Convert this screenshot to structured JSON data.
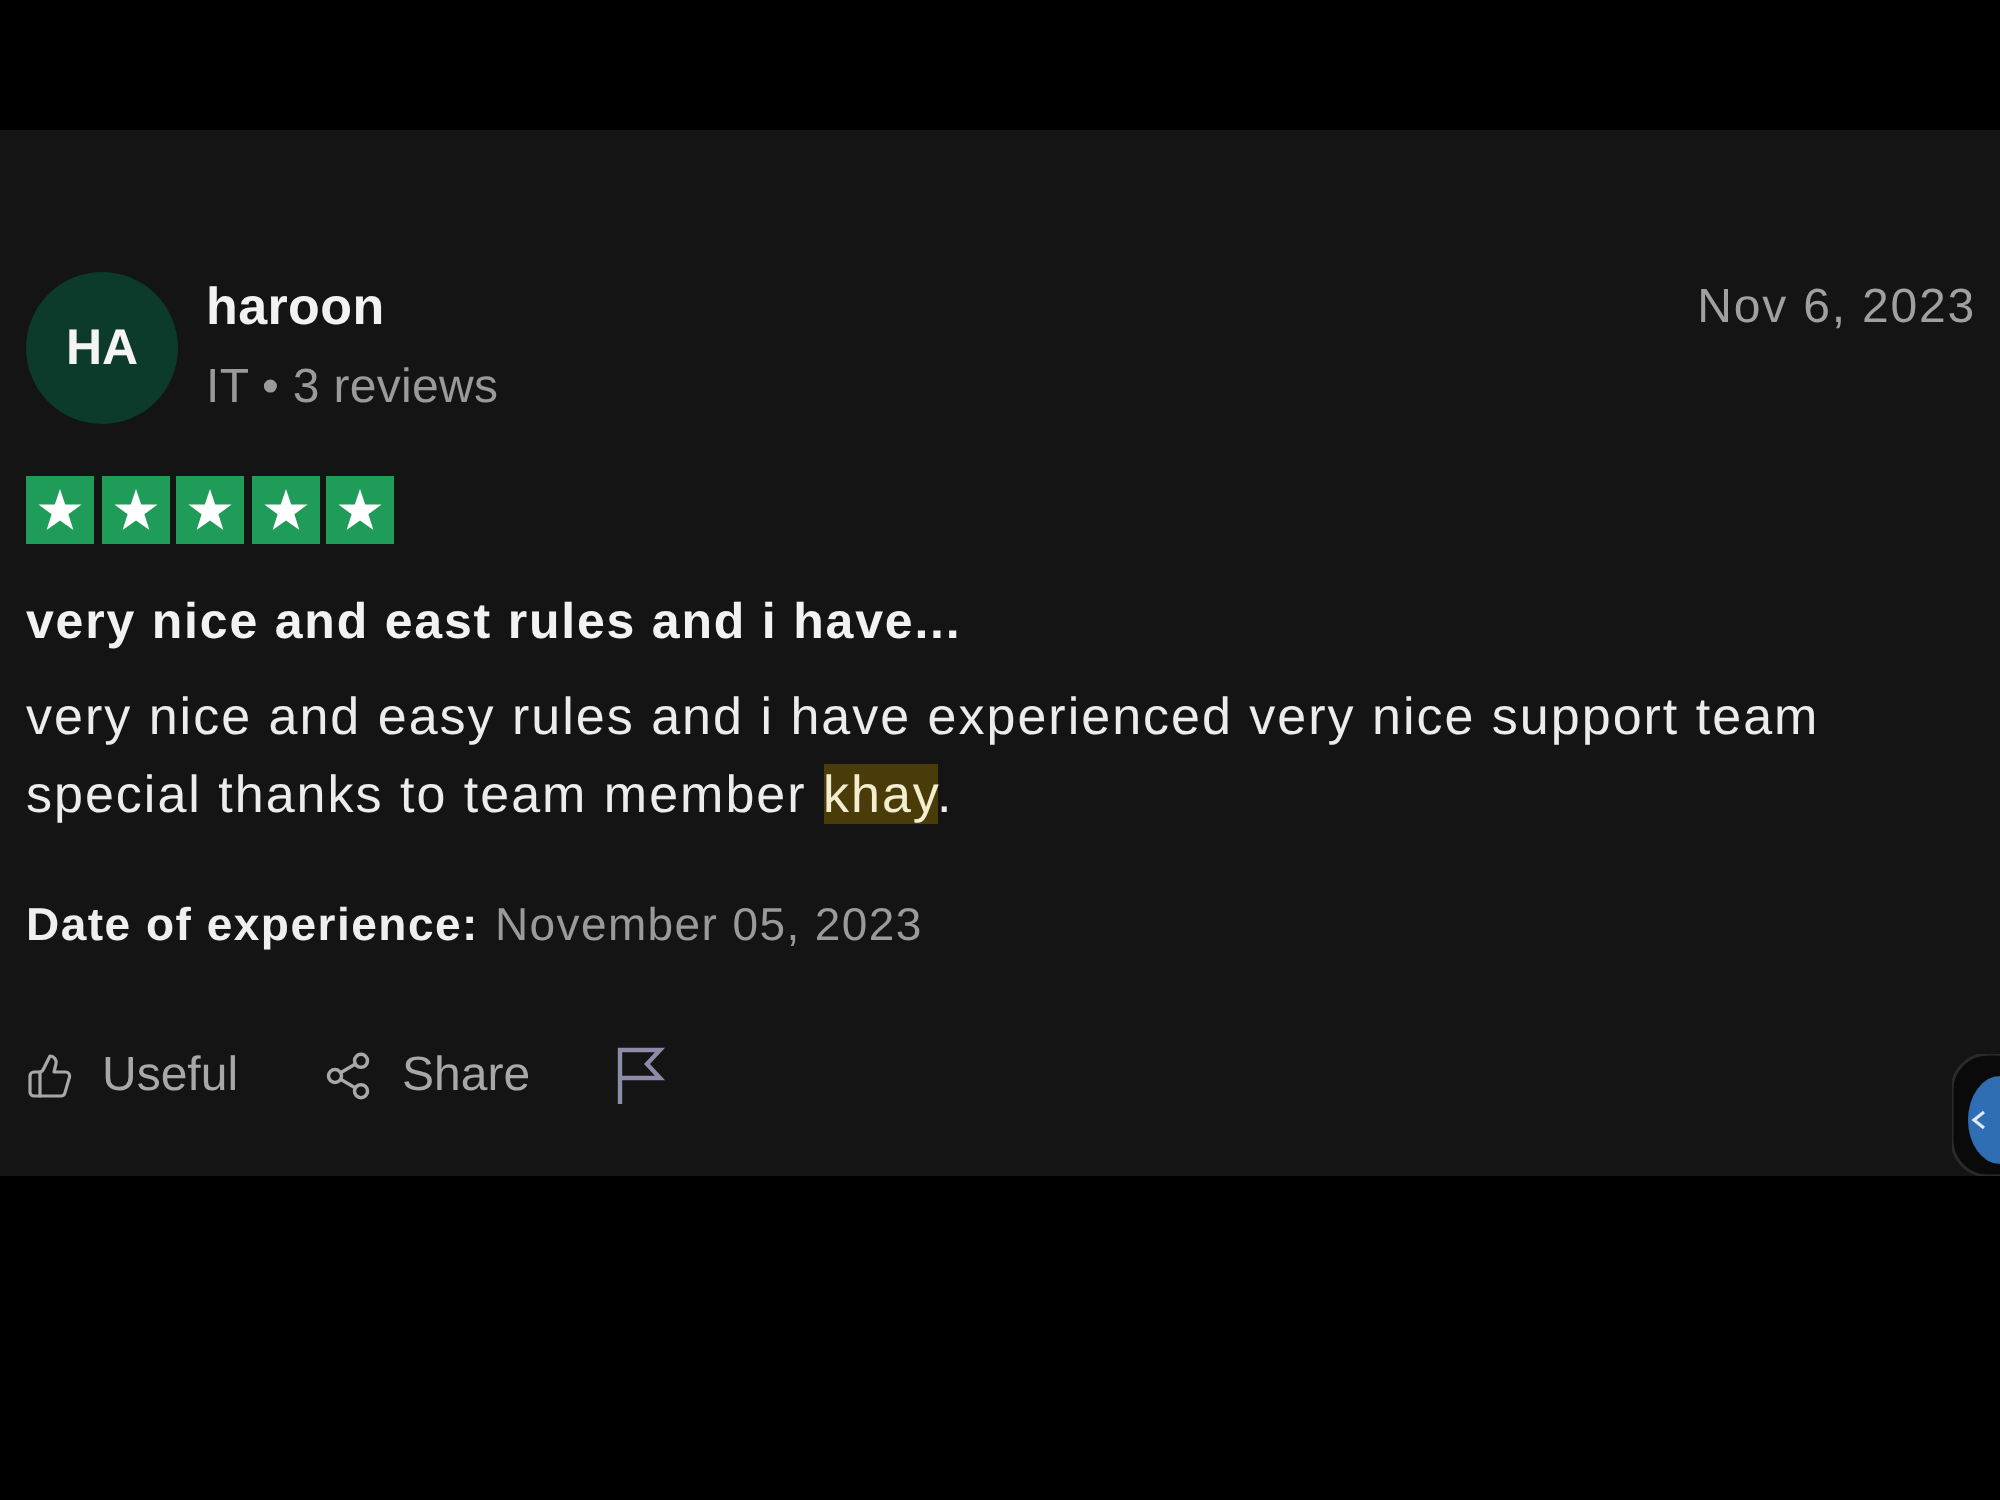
{
  "reviewer": {
    "initials": "HA",
    "name": "haroon",
    "meta": "IT • 3 reviews"
  },
  "date": "Nov 6, 2023",
  "stars": 5,
  "title": "very nice and east rules and i have...",
  "body": [
    {
      "text": "very nice and easy rules and i have experienced very nice support team special thanks to team member ",
      "highlighted": false
    },
    {
      "text": "khay",
      "highlighted": true
    },
    {
      "text": ".",
      "highlighted": false
    }
  ],
  "experience": {
    "label": "Date of experience:",
    "value": "November 05, 2023"
  },
  "actions": [
    {
      "kind": "useful",
      "label": "Useful"
    },
    {
      "kind": "share",
      "label": "Share"
    },
    {
      "kind": "flag"
    }
  ]
}
